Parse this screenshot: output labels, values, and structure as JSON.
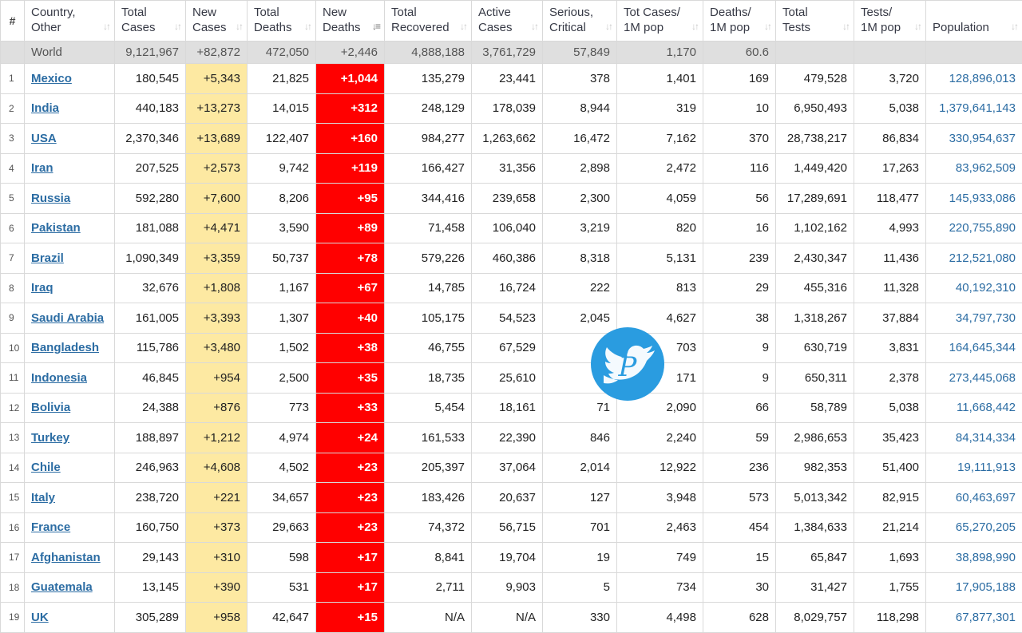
{
  "headers": {
    "hash": "#",
    "country": [
      "Country,",
      "Other"
    ],
    "total_cases": [
      "Total",
      "Cases"
    ],
    "new_cases": [
      "New",
      "Cases"
    ],
    "total_deaths": [
      "Total",
      "Deaths"
    ],
    "new_deaths": [
      "New",
      "Deaths"
    ],
    "total_recovered": [
      "Total",
      "Recovered"
    ],
    "active_cases": [
      "Active",
      "Cases"
    ],
    "serious": [
      "Serious,",
      "Critical"
    ],
    "cases_per_m": [
      "Tot Cases/",
      "1M pop"
    ],
    "deaths_per_m": [
      "Deaths/",
      "1M pop"
    ],
    "total_tests": [
      "Total",
      "Tests"
    ],
    "tests_per_m": [
      "Tests/",
      "1M pop"
    ],
    "population": [
      "Population"
    ]
  },
  "world": {
    "name": "World",
    "total_cases": "9,121,967",
    "new_cases": "+82,872",
    "total_deaths": "472,050",
    "new_deaths": "+2,446",
    "total_recovered": "4,888,188",
    "active_cases": "3,761,729",
    "serious": "57,849",
    "cases_per_m": "1,170",
    "deaths_per_m": "60.6"
  },
  "rows": [
    {
      "num": "1",
      "country": "Mexico",
      "total_cases": "180,545",
      "new_cases": "+5,343",
      "total_deaths": "21,825",
      "new_deaths": "+1,044",
      "total_recovered": "135,279",
      "active_cases": "23,441",
      "serious": "378",
      "cases_per_m": "1,401",
      "deaths_per_m": "169",
      "total_tests": "479,528",
      "tests_per_m": "3,720",
      "population": "128,896,013"
    },
    {
      "num": "2",
      "country": "India",
      "total_cases": "440,183",
      "new_cases": "+13,273",
      "total_deaths": "14,015",
      "new_deaths": "+312",
      "total_recovered": "248,129",
      "active_cases": "178,039",
      "serious": "8,944",
      "cases_per_m": "319",
      "deaths_per_m": "10",
      "total_tests": "6,950,493",
      "tests_per_m": "5,038",
      "population": "1,379,641,143"
    },
    {
      "num": "3",
      "country": "USA",
      "total_cases": "2,370,346",
      "new_cases": "+13,689",
      "total_deaths": "122,407",
      "new_deaths": "+160",
      "total_recovered": "984,277",
      "active_cases": "1,263,662",
      "serious": "16,472",
      "cases_per_m": "7,162",
      "deaths_per_m": "370",
      "total_tests": "28,738,217",
      "tests_per_m": "86,834",
      "population": "330,954,637"
    },
    {
      "num": "4",
      "country": "Iran",
      "total_cases": "207,525",
      "new_cases": "+2,573",
      "total_deaths": "9,742",
      "new_deaths": "+119",
      "total_recovered": "166,427",
      "active_cases": "31,356",
      "serious": "2,898",
      "cases_per_m": "2,472",
      "deaths_per_m": "116",
      "total_tests": "1,449,420",
      "tests_per_m": "17,263",
      "population": "83,962,509"
    },
    {
      "num": "5",
      "country": "Russia",
      "total_cases": "592,280",
      "new_cases": "+7,600",
      "total_deaths": "8,206",
      "new_deaths": "+95",
      "total_recovered": "344,416",
      "active_cases": "239,658",
      "serious": "2,300",
      "cases_per_m": "4,059",
      "deaths_per_m": "56",
      "total_tests": "17,289,691",
      "tests_per_m": "118,477",
      "population": "145,933,086"
    },
    {
      "num": "6",
      "country": "Pakistan",
      "total_cases": "181,088",
      "new_cases": "+4,471",
      "total_deaths": "3,590",
      "new_deaths": "+89",
      "total_recovered": "71,458",
      "active_cases": "106,040",
      "serious": "3,219",
      "cases_per_m": "820",
      "deaths_per_m": "16",
      "total_tests": "1,102,162",
      "tests_per_m": "4,993",
      "population": "220,755,890"
    },
    {
      "num": "7",
      "country": "Brazil",
      "total_cases": "1,090,349",
      "new_cases": "+3,359",
      "total_deaths": "50,737",
      "new_deaths": "+78",
      "total_recovered": "579,226",
      "active_cases": "460,386",
      "serious": "8,318",
      "cases_per_m": "5,131",
      "deaths_per_m": "239",
      "total_tests": "2,430,347",
      "tests_per_m": "11,436",
      "population": "212,521,080"
    },
    {
      "num": "8",
      "country": "Iraq",
      "total_cases": "32,676",
      "new_cases": "+1,808",
      "total_deaths": "1,167",
      "new_deaths": "+67",
      "total_recovered": "14,785",
      "active_cases": "16,724",
      "serious": "222",
      "cases_per_m": "813",
      "deaths_per_m": "29",
      "total_tests": "455,316",
      "tests_per_m": "11,328",
      "population": "40,192,310"
    },
    {
      "num": "9",
      "country": "Saudi Arabia",
      "total_cases": "161,005",
      "new_cases": "+3,393",
      "total_deaths": "1,307",
      "new_deaths": "+40",
      "total_recovered": "105,175",
      "active_cases": "54,523",
      "serious": "2,045",
      "cases_per_m": "4,627",
      "deaths_per_m": "38",
      "total_tests": "1,318,267",
      "tests_per_m": "37,884",
      "population": "34,797,730"
    },
    {
      "num": "10",
      "country": "Bangladesh",
      "total_cases": "115,786",
      "new_cases": "+3,480",
      "total_deaths": "1,502",
      "new_deaths": "+38",
      "total_recovered": "46,755",
      "active_cases": "67,529",
      "serious": "",
      "cases_per_m": "703",
      "deaths_per_m": "9",
      "total_tests": "630,719",
      "tests_per_m": "3,831",
      "population": "164,645,344"
    },
    {
      "num": "11",
      "country": "Indonesia",
      "total_cases": "46,845",
      "new_cases": "+954",
      "total_deaths": "2,500",
      "new_deaths": "+35",
      "total_recovered": "18,735",
      "active_cases": "25,610",
      "serious": "",
      "cases_per_m": "171",
      "deaths_per_m": "9",
      "total_tests": "650,311",
      "tests_per_m": "2,378",
      "population": "273,445,068"
    },
    {
      "num": "12",
      "country": "Bolivia",
      "total_cases": "24,388",
      "new_cases": "+876",
      "total_deaths": "773",
      "new_deaths": "+33",
      "total_recovered": "5,454",
      "active_cases": "18,161",
      "serious": "71",
      "cases_per_m": "2,090",
      "deaths_per_m": "66",
      "total_tests": "58,789",
      "tests_per_m": "5,038",
      "population": "11,668,442"
    },
    {
      "num": "13",
      "country": "Turkey",
      "total_cases": "188,897",
      "new_cases": "+1,212",
      "total_deaths": "4,974",
      "new_deaths": "+24",
      "total_recovered": "161,533",
      "active_cases": "22,390",
      "serious": "846",
      "cases_per_m": "2,240",
      "deaths_per_m": "59",
      "total_tests": "2,986,653",
      "tests_per_m": "35,423",
      "population": "84,314,334"
    },
    {
      "num": "14",
      "country": "Chile",
      "total_cases": "246,963",
      "new_cases": "+4,608",
      "total_deaths": "4,502",
      "new_deaths": "+23",
      "total_recovered": "205,397",
      "active_cases": "37,064",
      "serious": "2,014",
      "cases_per_m": "12,922",
      "deaths_per_m": "236",
      "total_tests": "982,353",
      "tests_per_m": "51,400",
      "population": "19,111,913"
    },
    {
      "num": "15",
      "country": "Italy",
      "total_cases": "238,720",
      "new_cases": "+221",
      "total_deaths": "34,657",
      "new_deaths": "+23",
      "total_recovered": "183,426",
      "active_cases": "20,637",
      "serious": "127",
      "cases_per_m": "3,948",
      "deaths_per_m": "573",
      "total_tests": "5,013,342",
      "tests_per_m": "82,915",
      "population": "60,463,697"
    },
    {
      "num": "16",
      "country": "France",
      "total_cases": "160,750",
      "new_cases": "+373",
      "total_deaths": "29,663",
      "new_deaths": "+23",
      "total_recovered": "74,372",
      "active_cases": "56,715",
      "serious": "701",
      "cases_per_m": "2,463",
      "deaths_per_m": "454",
      "total_tests": "1,384,633",
      "tests_per_m": "21,214",
      "population": "65,270,205"
    },
    {
      "num": "17",
      "country": "Afghanistan",
      "total_cases": "29,143",
      "new_cases": "+310",
      "total_deaths": "598",
      "new_deaths": "+17",
      "total_recovered": "8,841",
      "active_cases": "19,704",
      "serious": "19",
      "cases_per_m": "749",
      "deaths_per_m": "15",
      "total_tests": "65,847",
      "tests_per_m": "1,693",
      "population": "38,898,990"
    },
    {
      "num": "18",
      "country": "Guatemala",
      "total_cases": "13,145",
      "new_cases": "+390",
      "total_deaths": "531",
      "new_deaths": "+17",
      "total_recovered": "2,711",
      "active_cases": "9,903",
      "serious": "5",
      "cases_per_m": "734",
      "deaths_per_m": "30",
      "total_tests": "31,427",
      "tests_per_m": "1,755",
      "population": "17,905,188"
    },
    {
      "num": "19",
      "country": "UK",
      "total_cases": "305,289",
      "new_cases": "+958",
      "total_deaths": "42,647",
      "new_deaths": "+15",
      "total_recovered": "N/A",
      "active_cases": "N/A",
      "serious": "330",
      "cases_per_m": "4,498",
      "deaths_per_m": "628",
      "total_tests": "8,029,757",
      "tests_per_m": "118,298",
      "population": "67,877,301"
    }
  ],
  "watermark": {
    "letter": "P"
  },
  "colors": {
    "new_cases_bg": "#fde9a2",
    "new_deaths_bg": "#ff0000",
    "link": "#2b6ca3",
    "world_bg": "#dfdfdf"
  }
}
